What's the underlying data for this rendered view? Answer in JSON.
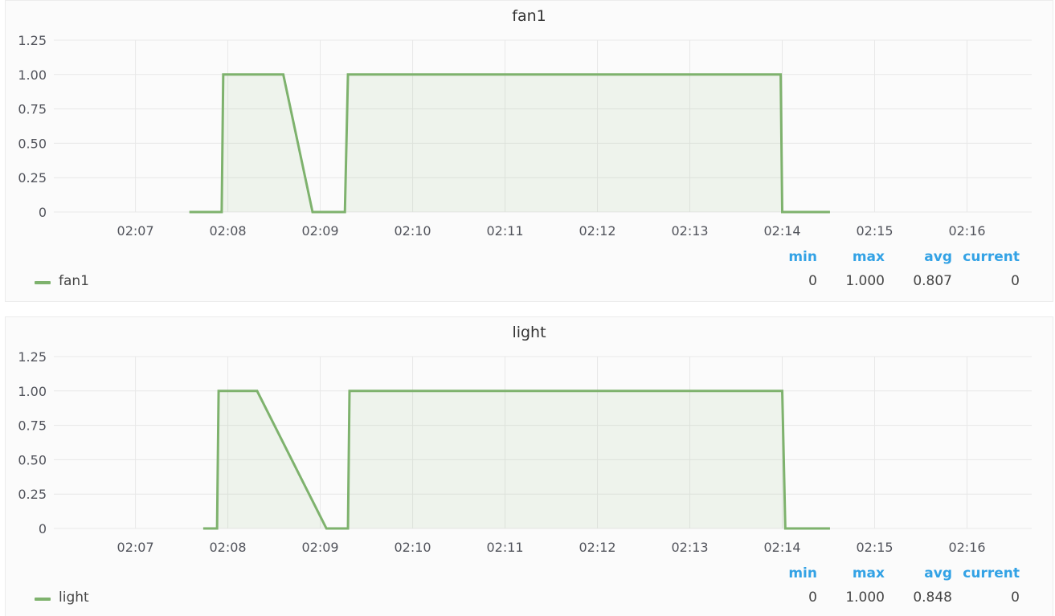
{
  "chart_data": [
    {
      "type": "area",
      "title": "fan1",
      "x_ticks": [
        "02:07",
        "02:08",
        "02:09",
        "02:10",
        "02:11",
        "02:12",
        "02:13",
        "02:14",
        "02:15",
        "02:16"
      ],
      "y_ticks": [
        "0",
        "0.25",
        "0.50",
        "0.75",
        "1.00",
        "1.25"
      ],
      "ylim": [
        0,
        1.25
      ],
      "xlim": [
        "02:06:07",
        "02:16:42"
      ],
      "grid": true,
      "legend_position": "bottom-left",
      "series": [
        {
          "name": "fan1",
          "color": "#7eb26d",
          "x": [
            "02:07:35",
            "02:07:56",
            "02:07:57",
            "02:08:36",
            "02:08:55",
            "02:09:16",
            "02:09:18",
            "02:13:59",
            "02:14:00",
            "02:14:31"
          ],
          "values": [
            0,
            0,
            1,
            1,
            0,
            0,
            1,
            1,
            0,
            0
          ],
          "stats": {
            "min": "0",
            "max": "1.000",
            "avg": "0.807",
            "current": "0"
          }
        }
      ]
    },
    {
      "type": "area",
      "title": "light",
      "x_ticks": [
        "02:07",
        "02:08",
        "02:09",
        "02:10",
        "02:11",
        "02:12",
        "02:13",
        "02:14",
        "02:15",
        "02:16"
      ],
      "y_ticks": [
        "0",
        "0.25",
        "0.50",
        "0.75",
        "1.00",
        "1.25"
      ],
      "ylim": [
        0,
        1.25
      ],
      "xlim": [
        "02:06:07",
        "02:16:42"
      ],
      "grid": true,
      "legend_position": "bottom-left",
      "series": [
        {
          "name": "light",
          "color": "#7eb26d",
          "x": [
            "02:07:44",
            "02:07:53",
            "02:07:54",
            "02:08:19",
            "02:09:04",
            "02:09:18",
            "02:09:19",
            "02:14:00",
            "02:14:02",
            "02:14:31"
          ],
          "values": [
            0,
            0,
            1,
            1,
            0,
            0,
            1,
            1,
            0,
            0
          ],
          "stats": {
            "min": "0",
            "max": "1.000",
            "avg": "0.848",
            "current": "0"
          }
        }
      ]
    }
  ],
  "legend_headers": {
    "min": "min",
    "max": "max",
    "avg": "avg",
    "current": "current"
  }
}
